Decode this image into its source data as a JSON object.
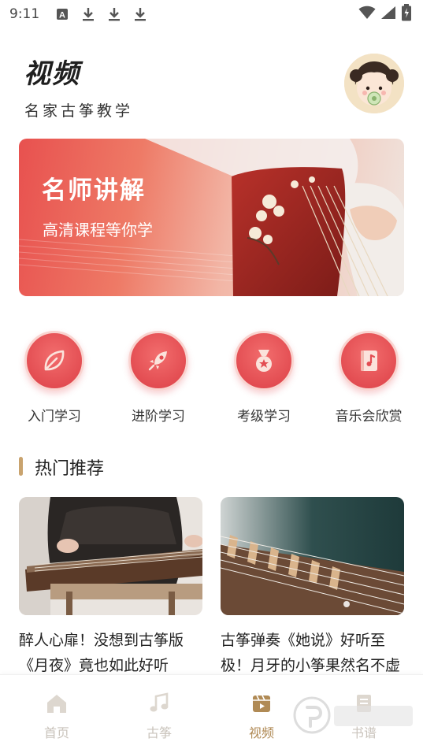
{
  "status_bar": {
    "time": "9:11"
  },
  "header": {
    "title": "视频",
    "subtitle": "名家古筝教学"
  },
  "banner": {
    "heading": "名师讲解",
    "subheading": "高清课程等你学"
  },
  "categories": [
    {
      "label": "入门学习",
      "icon": "leaf-icon"
    },
    {
      "label": "进阶学习",
      "icon": "rocket-icon"
    },
    {
      "label": "考级学习",
      "icon": "medal-icon"
    },
    {
      "label": "音乐会欣赏",
      "icon": "music-book-icon"
    }
  ],
  "section": {
    "title": "热门推荐"
  },
  "videos": [
    {
      "title": "醉人心扉！没想到古筝版《月夜》竟也如此好听"
    },
    {
      "title": "古筝弹奏《她说》好听至极！月牙的小筝果然名不虚传"
    }
  ],
  "tabbar": {
    "items": [
      {
        "label": "首页",
        "icon": "home-icon",
        "active": false
      },
      {
        "label": "古筝",
        "icon": "music-note-icon",
        "active": false
      },
      {
        "label": "视频",
        "icon": "video-icon",
        "active": true
      },
      {
        "label": "书谱",
        "icon": "book-icon",
        "active": false
      }
    ]
  },
  "colors": {
    "accent": "#e34d52",
    "gold": "#b08a55",
    "inactive": "#c9c3bb"
  }
}
